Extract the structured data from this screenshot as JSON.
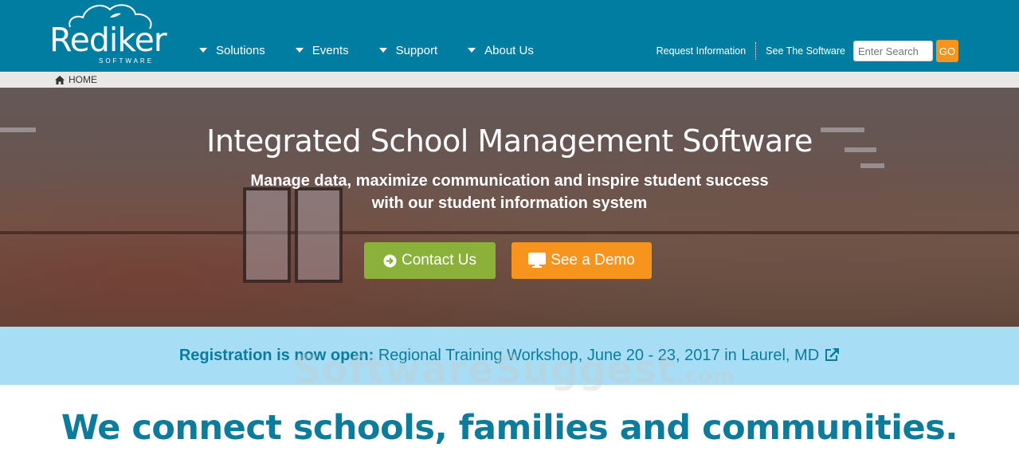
{
  "brand": {
    "name": "Rediker",
    "subtitle": "SOFTWARE",
    "colors": {
      "header": "#007da0",
      "accent_orange": "#f7941d",
      "accent_green": "#8bb13a",
      "banner": "#a8def5",
      "teal_text": "#0d7c9c"
    }
  },
  "nav": {
    "items": [
      {
        "label": "Solutions",
        "icon": "caret-down-icon"
      },
      {
        "label": "Events",
        "icon": "caret-down-icon"
      },
      {
        "label": "Support",
        "icon": "caret-down-icon"
      },
      {
        "label": "About Us",
        "icon": "caret-down-icon"
      }
    ]
  },
  "utility": {
    "request_info": "Request Information",
    "see_software": "See The Software",
    "search_placeholder": "Enter Search",
    "go_label": "GO"
  },
  "breadcrumb": {
    "icon": "home-icon",
    "label": "HOME"
  },
  "hero": {
    "title": "Integrated School Management Software",
    "subtitle_line1": "Manage data, maximize communication and inspire student success",
    "subtitle_line2": "with our student information system",
    "contact_button": {
      "label": "Contact Us",
      "icon": "arrow-circle-right-icon"
    },
    "demo_button": {
      "label": "See a Demo",
      "icon": "monitor-icon"
    }
  },
  "banner": {
    "lead": "Registration is now open:",
    "text": " Regional Training Workshop, June 20 - 23, 2017 in Laurel, MD",
    "icon": "external-link-icon"
  },
  "watermark": {
    "main": "SoftwareSuggest",
    "suffix": ".com"
  },
  "tagline": "We connect schools, families and communities."
}
